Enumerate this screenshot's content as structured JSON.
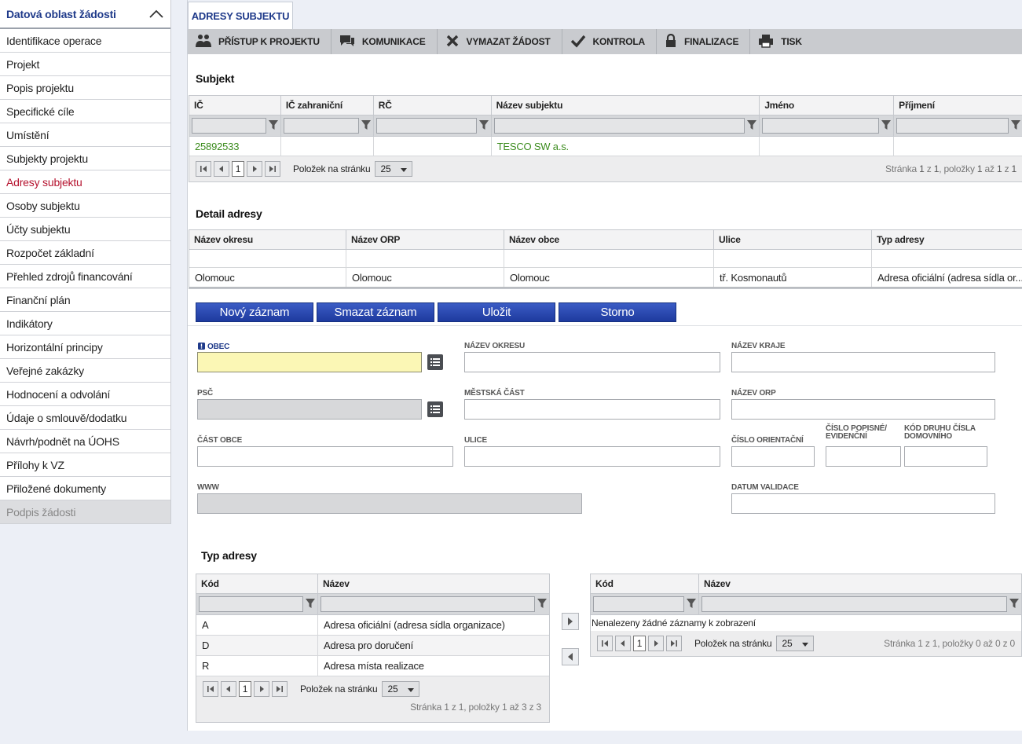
{
  "sidebar": {
    "title": "Datová oblast žádosti",
    "items": [
      {
        "label": "Identifikace operace"
      },
      {
        "label": "Projekt"
      },
      {
        "label": "Popis projektu"
      },
      {
        "label": "Specifické cíle"
      },
      {
        "label": "Umístění"
      },
      {
        "label": "Subjekty projektu"
      },
      {
        "label": "Adresy subjektu",
        "active": true
      },
      {
        "label": "Osoby subjektu"
      },
      {
        "label": "Účty subjektu"
      },
      {
        "label": "Rozpočet základní"
      },
      {
        "label": "Přehled zdrojů financování"
      },
      {
        "label": "Finanční plán"
      },
      {
        "label": "Indikátory"
      },
      {
        "label": "Horizontální principy"
      },
      {
        "label": "Veřejné zakázky"
      },
      {
        "label": "Hodnocení a odvolání"
      },
      {
        "label": "Údaje o smlouvě/dodatku"
      },
      {
        "label": "Návrh/podnět na ÚOHS"
      },
      {
        "label": "Přílohy k VZ"
      },
      {
        "label": "Přiložené dokumenty"
      },
      {
        "label": "Podpis žádosti",
        "disabled": true
      }
    ]
  },
  "tab": {
    "label": "ADRESY SUBJEKTU"
  },
  "toolbar": {
    "access": "PŘÍSTUP K PROJEKTU",
    "communication": "KOMUNIKACE",
    "delete": "VYMAZAT ŽÁDOST",
    "check": "KONTROLA",
    "finalize": "FINALIZACE",
    "print": "TISK"
  },
  "subject": {
    "title": "Subjekt",
    "columns": [
      "IČ",
      "IČ zahraniční",
      "RČ",
      "Název subjektu",
      "Jméno",
      "Příjmení"
    ],
    "row": {
      "ic": "25892533",
      "ic_foreign": "",
      "rc": "",
      "name": "TESCO SW a.s.",
      "first": "",
      "last": ""
    },
    "pager": {
      "page": "1",
      "per_page_label": "Položek na stránku",
      "per_page": "25",
      "info_prefix": "Stránka",
      "info_page": "1",
      "info_of": "z",
      "info_pages": "1",
      "info_items": ", položky",
      "info_from": "1",
      "info_to_word": "až",
      "info_to": "1",
      "info_total_word": "z",
      "info_total": "1"
    }
  },
  "address_detail": {
    "title": "Detail adresy",
    "columns": [
      "Název okresu",
      "Název ORP",
      "Název obce",
      "Ulice",
      "Typ adresy"
    ],
    "row": {
      "district": "Olomouc",
      "orp": "Olomouc",
      "municipality": "Olomouc",
      "street": "tř. Kosmonautů",
      "type": "Adresa oficiální (adresa sídla or..."
    }
  },
  "buttons": {
    "new": "Nový záznam",
    "delete": "Smazat záznam",
    "save": "Uložit",
    "cancel": "Storno"
  },
  "form": {
    "obec": {
      "label": "OBEC",
      "value": ""
    },
    "okres": {
      "label": "NÁZEV OKRESU",
      "value": ""
    },
    "kraj": {
      "label": "NÁZEV KRAJE",
      "value": ""
    },
    "psc": {
      "label": "PSČ",
      "value": ""
    },
    "mestska_cast": {
      "label": "MĚSTSKÁ ČÁST",
      "value": ""
    },
    "orp": {
      "label": "NÁZEV ORP",
      "value": ""
    },
    "cast_obce": {
      "label": "ČÁST OBCE",
      "value": ""
    },
    "ulice": {
      "label": "ULICE",
      "value": ""
    },
    "cislo_orientacni": {
      "label": "ČÍSLO ORIENTAČNÍ",
      "value": ""
    },
    "cislo_popisne": {
      "label": "ČÍSLO POPISNÉ/ EVIDENČNÍ",
      "value": ""
    },
    "kod_druhu": {
      "label": "KÓD DRUHU ČÍSLA DOMOVNÍHO",
      "value": ""
    },
    "www": {
      "label": "WWW",
      "value": ""
    },
    "datum_validace": {
      "label": "DATUM VALIDACE",
      "value": ""
    }
  },
  "address_type": {
    "title": "Typ adresy",
    "left": {
      "columns": [
        "Kód",
        "Název"
      ],
      "rows": [
        {
          "code": "A",
          "name": "Adresa oficiální (adresa sídla organizace)"
        },
        {
          "code": "D",
          "name": "Adresa pro doručení"
        },
        {
          "code": "R",
          "name": "Adresa místa realizace"
        }
      ],
      "pager": {
        "page": "1",
        "per_page_label": "Položek na stránku",
        "per_page": "25",
        "info": "Stránka 1 z 1, položky 1 až 3 z 3"
      }
    },
    "right": {
      "columns": [
        "Kód",
        "Název"
      ],
      "empty": "Nenalezeny žádné záznamy k zobrazení",
      "pager": {
        "page": "1",
        "per_page_label": "Položek na stránku",
        "per_page": "25",
        "info": "Stránka 1 z 1, položky 0 až 0 z 0"
      }
    }
  },
  "colors": {
    "accent": "#1f3a8a",
    "active_nav": "#b5122e",
    "link_green": "#3c8c1e",
    "button_blue": "#2a4ab2"
  }
}
